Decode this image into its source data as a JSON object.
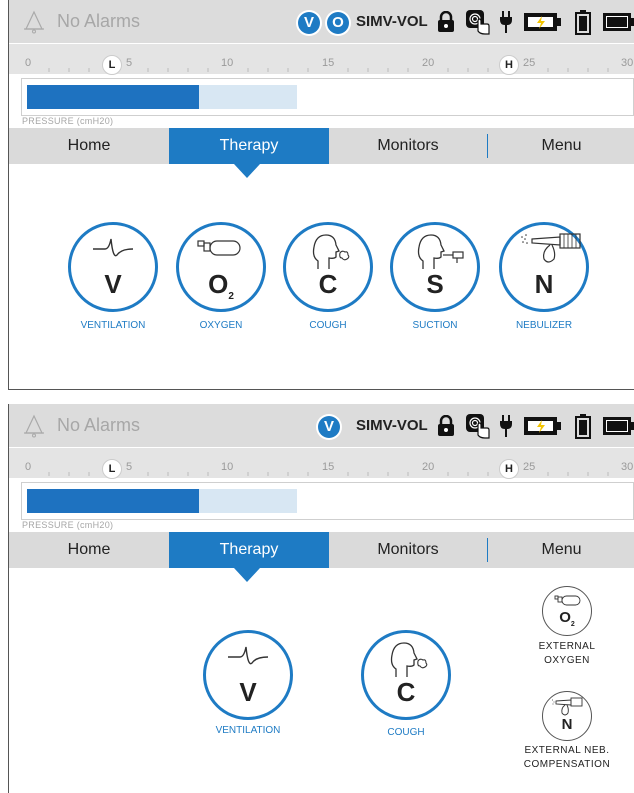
{
  "screen1": {
    "alarm_text": "No Alarms",
    "mode_badges": [
      "V",
      "O"
    ],
    "mode_label": "SIMV-VOL",
    "scale_numbers": [
      "0",
      "5",
      "10",
      "15",
      "20",
      "25",
      "30"
    ],
    "low_marker": "L",
    "high_marker": "H",
    "gauge_label": "PRESSURE (cmH20)",
    "tabs": [
      "Home",
      "Therapy",
      "Monitors",
      "Menu"
    ],
    "therapies": [
      {
        "letter": "V",
        "caption": "VENTILATION",
        "icon": "waveform-icon"
      },
      {
        "letter": "O",
        "sub": "2",
        "caption": "OXYGEN",
        "icon": "oxygen-tank-icon"
      },
      {
        "letter": "C",
        "caption": "COUGH",
        "icon": "cough-head-icon"
      },
      {
        "letter": "S",
        "caption": "SUCTION",
        "icon": "suction-head-icon"
      },
      {
        "letter": "N",
        "caption": "NEBULIZER",
        "icon": "nebulizer-icon"
      }
    ]
  },
  "screen2": {
    "alarm_text": "No Alarms",
    "mode_badges": [
      "V"
    ],
    "mode_label": "SIMV-VOL",
    "scale_numbers": [
      "0",
      "5",
      "10",
      "15",
      "20",
      "25",
      "30"
    ],
    "low_marker": "L",
    "high_marker": "H",
    "gauge_label": "PRESSURE (cmH20)",
    "tabs": [
      "Home",
      "Therapy",
      "Monitors",
      "Menu"
    ],
    "therapies": [
      {
        "letter": "V",
        "caption": "VENTILATION",
        "icon": "waveform-icon"
      },
      {
        "letter": "C",
        "caption": "COUGH",
        "icon": "cough-head-icon"
      }
    ],
    "external": [
      {
        "letter": "O",
        "sub": "2",
        "caption_lines": [
          "EXTERNAL",
          "OXYGEN"
        ],
        "icon": "oxygen-tank-icon"
      },
      {
        "letter": "N",
        "caption_lines": [
          "EXTERNAL NEB.",
          "COMPENSATION"
        ],
        "icon": "nebulizer-icon"
      }
    ]
  },
  "colors": {
    "accent": "#1e7bc4",
    "status_bar": "#dcdcdc",
    "gauge_fill": "#1e72c0"
  }
}
